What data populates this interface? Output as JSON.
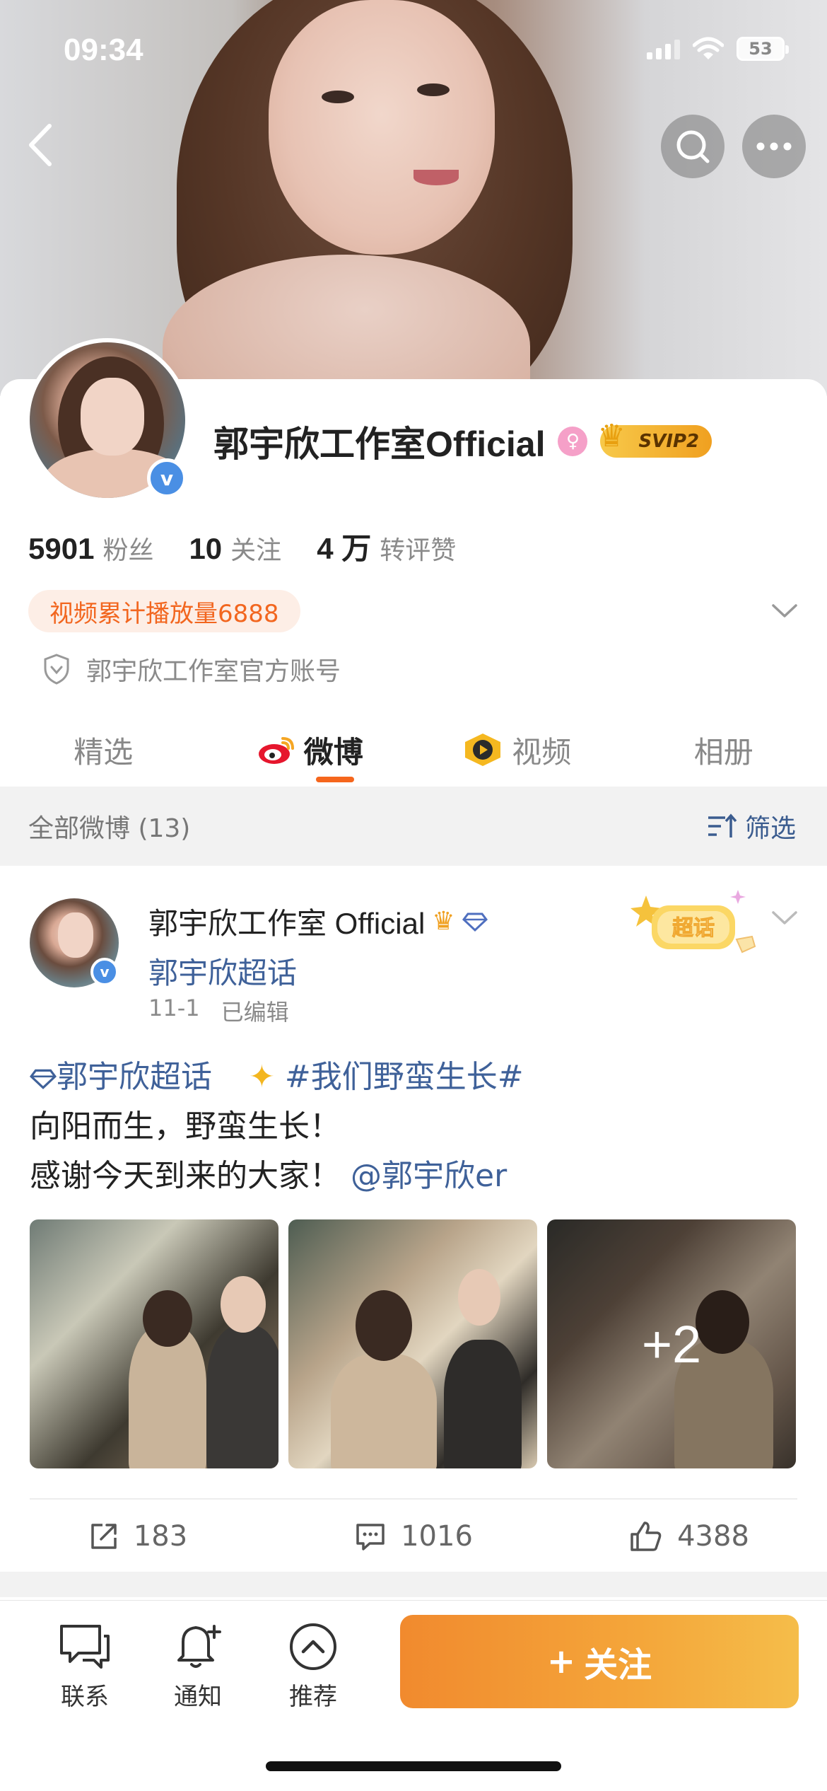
{
  "status_bar": {
    "time": "09:34",
    "battery": "53"
  },
  "profile": {
    "name": "郭宇欣工作室Official",
    "svip_label": "SVIP2",
    "stats": [
      {
        "value": "5901",
        "label": "粉丝"
      },
      {
        "value": "10",
        "label": "关注"
      },
      {
        "value": "4 万",
        "label": "转评赞"
      }
    ],
    "play_tag": "视频累计播放量6888",
    "official_desc": "郭宇欣工作室官方账号"
  },
  "tabs": [
    {
      "label": "精选",
      "active": false
    },
    {
      "label": "微博",
      "active": true
    },
    {
      "label": "视频",
      "active": false
    },
    {
      "label": "相册",
      "active": false
    }
  ],
  "feed_bar": {
    "label": "全部微博 (13)",
    "filter_label": "筛选"
  },
  "post": {
    "author": "郭宇欣工作室 Official",
    "topic": "郭宇欣超话",
    "date": "11-1",
    "edited": "已编辑",
    "super_badge": "超话",
    "text": {
      "topic_tag": "郭宇欣超话",
      "hashtag": "#我们野蛮生长#",
      "line2": "向阳而生，野蛮生长！",
      "line3": "感谢今天到来的大家！",
      "mention": "@郭宇欣er"
    },
    "more_photos": "+2",
    "actions": {
      "reposts": "183",
      "comments": "1016",
      "likes": "4388"
    }
  },
  "bottom_bar": {
    "items": [
      "联系",
      "通知",
      "推荐"
    ],
    "follow_label": "关注",
    "follow_plus": "+"
  }
}
